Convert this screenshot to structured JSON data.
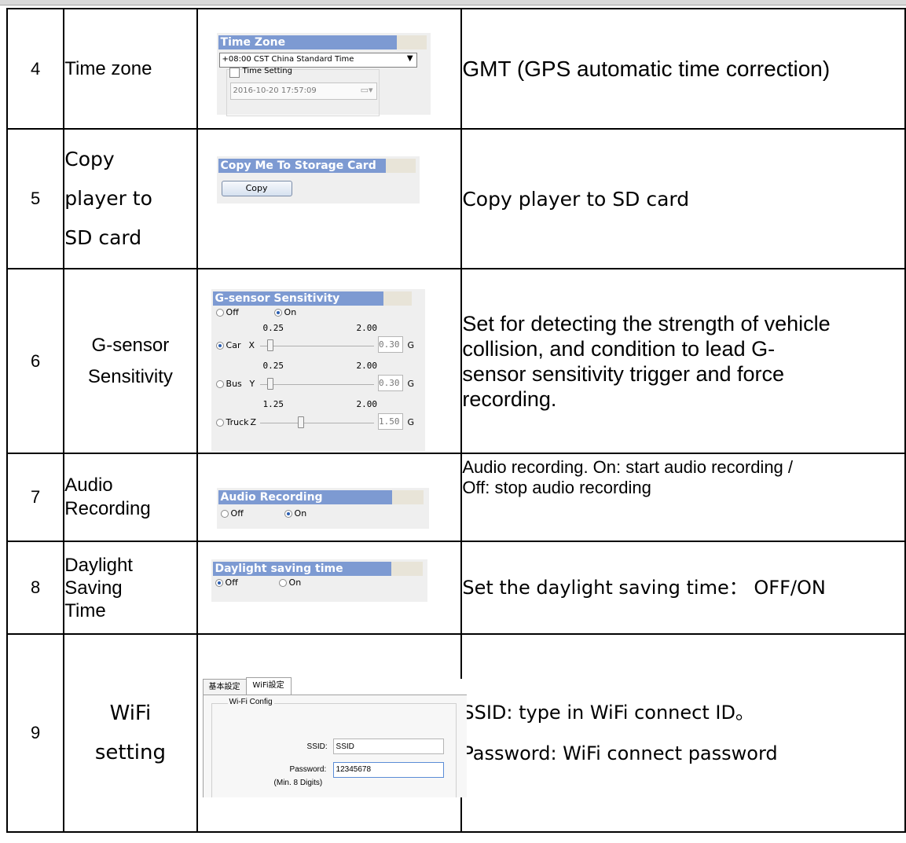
{
  "rows": [
    {
      "number": "4",
      "label": "Time zone",
      "description": "GMT (GPS automatic time correction)",
      "panel": {
        "title": "Time Zone",
        "timezone_value": "+08:00 CST China Standard Time",
        "checkbox_label": "Time Setting",
        "datetime_value": "2016-10-20 17:57:09"
      }
    },
    {
      "number": "5",
      "label_lines": [
        "Copy",
        "player to",
        "SD card"
      ],
      "description": "Copy player to SD card",
      "panel": {
        "title": "Copy Me To Storage Card",
        "button_label": "Copy"
      }
    },
    {
      "number": "6",
      "label_lines": [
        "G-sensor",
        "Sensitivity"
      ],
      "description": "Set for detecting the strength of vehicle collision, and condition to lead G-sensor sensitivity trigger and force recording.",
      "description_lines": [
        "Set for detecting the strength of vehicle",
        "collision, and condition to lead G-",
        "sensor sensitivity trigger and force",
        "recording."
      ],
      "panel": {
        "title": "G-sensor Sensitivity",
        "off_label": "Off",
        "on_label": "On",
        "selected": "On",
        "axes": [
          {
            "profile": "Car",
            "axis": "X",
            "min": "0.25",
            "max": "2.00",
            "value": "0.30",
            "unit": "G",
            "selected": true
          },
          {
            "profile": "Bus",
            "axis": "Y",
            "min": "0.25",
            "max": "2.00",
            "value": "0.30",
            "unit": "G",
            "selected": false
          },
          {
            "profile": "Truck",
            "axis": "Z",
            "min": "1.25",
            "max": "2.00",
            "value": "1.50",
            "unit": "G",
            "selected": false
          }
        ]
      }
    },
    {
      "number": "7",
      "label_lines": [
        "Audio",
        "Recording"
      ],
      "description_lines": [
        "Audio recording. On: start audio recording /",
        "Off: stop audio recording"
      ],
      "panel": {
        "title": "Audio Recording",
        "off_label": "Off",
        "on_label": "On",
        "selected": "On"
      }
    },
    {
      "number": "8",
      "label_lines": [
        "Daylight",
        "Saving",
        "Time"
      ],
      "description": "Set the daylight saving time： OFF/ON",
      "panel": {
        "title": "Daylight saving time",
        "off_label": "Off",
        "on_label": "On",
        "selected": "Off"
      }
    },
    {
      "number": "9",
      "label_lines": [
        "WiFi",
        "setting"
      ],
      "description_lines": [
        "SSID: type in WiFi connect ID。",
        "Password: WiFi connect password"
      ],
      "panel": {
        "tabs": [
          "基本設定",
          "WiFi設定"
        ],
        "active_tab": "WiFi設定",
        "group_label": "Wi-Fi Config",
        "ssid_label": "SSID:",
        "ssid_value": "SSID",
        "password_label": "Password:",
        "password_value": "12345678",
        "password_hint": "(Min. 8 Digits)"
      }
    }
  ],
  "colors": {
    "panel_title_bg": "#7d9ad2",
    "panel_bg": "#efefef",
    "border": "#000000"
  }
}
